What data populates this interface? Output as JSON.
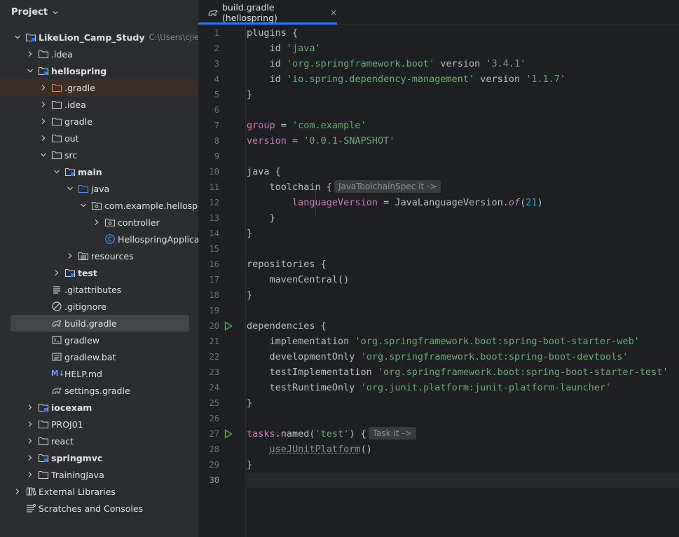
{
  "project_panel": {
    "title": "Project",
    "tree": [
      {
        "label": "LikeLion_Camp_Study",
        "path": "C:\\Users\\cjien\\L",
        "bold": true
      },
      {
        "label": ".idea"
      },
      {
        "label": "hellospring",
        "bold": true
      },
      {
        "label": ".gradle"
      },
      {
        "label": ".idea"
      },
      {
        "label": "gradle"
      },
      {
        "label": "out"
      },
      {
        "label": "src"
      },
      {
        "label": "main",
        "bold": true
      },
      {
        "label": "java"
      },
      {
        "label": "com.example.hellospring"
      },
      {
        "label": "controller"
      },
      {
        "label": "HellospringApplication"
      },
      {
        "label": "resources"
      },
      {
        "label": "test",
        "bold": true
      },
      {
        "label": ".gitattributes"
      },
      {
        "label": ".gitignore"
      },
      {
        "label": "build.gradle"
      },
      {
        "label": "gradlew"
      },
      {
        "label": "gradlew.bat"
      },
      {
        "label": "HELP.md",
        "icon_text": "M↓"
      },
      {
        "label": "settings.gradle"
      },
      {
        "label": "iocexam",
        "bold": true
      },
      {
        "label": "PROJ01"
      },
      {
        "label": "react"
      },
      {
        "label": "springmvc",
        "bold": true
      },
      {
        "label": "TrainingJava"
      },
      {
        "label": "External Libraries"
      },
      {
        "label": "Scratches and Consoles"
      }
    ]
  },
  "editor": {
    "tab": {
      "label": "build.gradle (hellospring)",
      "close": "×"
    },
    "line_numbers": [
      "1",
      "2",
      "3",
      "4",
      "5",
      "6",
      "7",
      "8",
      "9",
      "10",
      "11",
      "12",
      "13",
      "14",
      "15",
      "16",
      "17",
      "18",
      "19",
      "20",
      "21",
      "22",
      "23",
      "24",
      "25",
      "26",
      "27",
      "28",
      "29",
      "30"
    ],
    "code": {
      "l1": {
        "a": "plugins",
        "b": " {"
      },
      "l2": {
        "a": "    id ",
        "b": "'java'"
      },
      "l3": {
        "a": "    id ",
        "b": "'org.springframework.boot'",
        "c": " version ",
        "d": "'3.4.1'"
      },
      "l4": {
        "a": "    id ",
        "b": "'io.spring.dependency-management'",
        "c": " version ",
        "d": "'1.1.7'"
      },
      "l5": {
        "a": "}"
      },
      "l7": {
        "a": "group",
        "b": " = ",
        "c": "'com.example'"
      },
      "l8": {
        "a": "version",
        "b": " = ",
        "c": "'0.0.1-SNAPSHOT'"
      },
      "l10": {
        "a": "java {"
      },
      "l11": {
        "a": "    toolchain {",
        "hint": "JavaToolchainSpec it ->"
      },
      "l12": {
        "a": "        ",
        "b": "languageVersion",
        "c": " = JavaLanguageVersion.",
        "d": "of",
        "e": "(",
        "f": "21",
        "g": ")"
      },
      "l13": {
        "a": "    }"
      },
      "l14": {
        "a": "}"
      },
      "l16": {
        "a": "repositories {"
      },
      "l17": {
        "a": "    mavenCentral()"
      },
      "l18": {
        "a": "}"
      },
      "l20": {
        "a": "dependencies {"
      },
      "l21": {
        "a": "    implementation ",
        "b": "'org.springframework.boot:spring-boot-starter-web'"
      },
      "l22": {
        "a": "    developmentOnly ",
        "b": "'org.springframework.boot:spring-boot-devtools'"
      },
      "l23": {
        "a": "    testImplementation ",
        "b": "'org.springframework.boot:spring-boot-starter-test'"
      },
      "l24": {
        "a": "    testRuntimeOnly ",
        "b": "'org.junit.platform:junit-platform-launcher'"
      },
      "l25": {
        "a": "}"
      },
      "l27": {
        "a": "tasks",
        "b": ".named(",
        "c": "'test'",
        "d": ") {",
        "hint": "Task it ->"
      },
      "l28": {
        "a": "    ",
        "b": "useJUnitPlatform",
        "c": "()"
      },
      "l29": {
        "a": "}"
      }
    }
  },
  "colors": {
    "string": "#6aab73",
    "property": "#c77dbb",
    "number": "#2aacb8",
    "accent": "#3574f0",
    "folder_highlight": "#3a2e26"
  }
}
